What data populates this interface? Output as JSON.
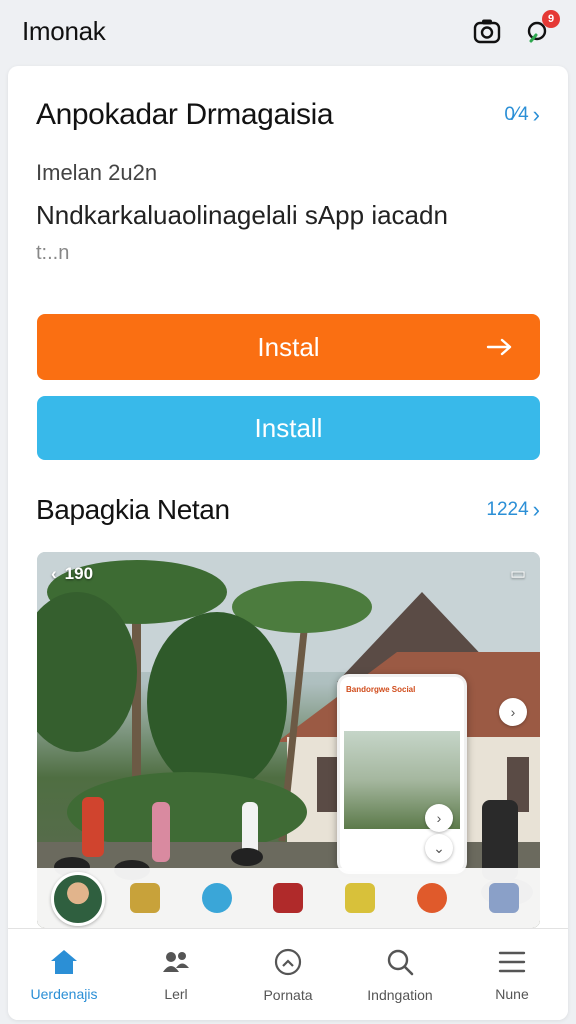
{
  "header": {
    "title": "Imonak",
    "notification_count": "9"
  },
  "featured": {
    "title": "Anpokadar Drmagaisia",
    "link_text": "0⁄4",
    "line1": "Imelan 2u2n",
    "line2": "Nndkarkaluaolinagelali sApp iacadn",
    "line3": "t:..n"
  },
  "buttons": {
    "primary_label": "Instal",
    "secondary_label": "Install"
  },
  "section2": {
    "title": "Bapagkia Netan",
    "link_text": "1224"
  },
  "photo": {
    "status_text": "190",
    "phone_title": "Bandorgwe Social"
  },
  "nav": [
    {
      "label": "Uerdenajis",
      "icon": "home-icon",
      "active": true
    },
    {
      "label": "Lerl",
      "icon": "people-icon",
      "active": false
    },
    {
      "label": "Pornata",
      "icon": "clock-icon",
      "active": false
    },
    {
      "label": "Indngation",
      "icon": "search-icon",
      "active": false
    },
    {
      "label": "Nune",
      "icon": "menu-icon",
      "active": false
    }
  ],
  "colors": {
    "accent_blue": "#2b8fd6",
    "primary_orange": "#fa6f12",
    "secondary_blue": "#38b9ea"
  }
}
